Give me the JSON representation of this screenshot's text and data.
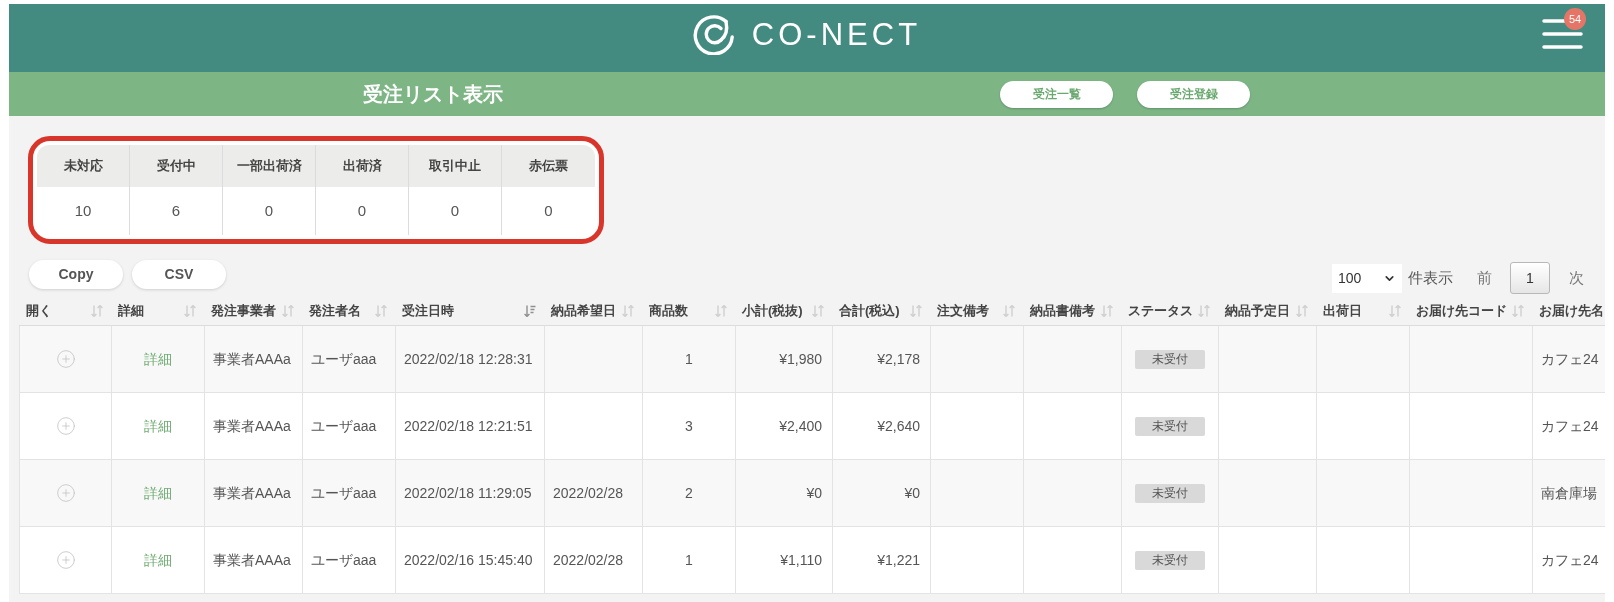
{
  "header": {
    "logo_text": "CO-NECT",
    "notification_count": "54"
  },
  "title_bar": {
    "title": "受注リスト表示",
    "buttons": [
      "受注一覧",
      "受注登録"
    ]
  },
  "status_summary": {
    "highlighted": true,
    "columns": [
      {
        "label": "未対応",
        "count": "10"
      },
      {
        "label": "受付中",
        "count": "6"
      },
      {
        "label": "一部出荷済",
        "count": "0"
      },
      {
        "label": "出荷済",
        "count": "0"
      },
      {
        "label": "取引中止",
        "count": "0"
      },
      {
        "label": "赤伝票",
        "count": "0"
      }
    ]
  },
  "toolbar": {
    "buttons": [
      "Copy",
      "CSV"
    ],
    "page_size": "100",
    "page_size_label": "件表示",
    "previous": "前",
    "current_page": "1",
    "next": "次"
  },
  "table": {
    "columns": [
      {
        "label": "開く",
        "sorted": false
      },
      {
        "label": "詳細",
        "sorted": false
      },
      {
        "label": "発注事業者",
        "sorted": false
      },
      {
        "label": "発注者名",
        "sorted": false
      },
      {
        "label": "受注日時",
        "sorted": true
      },
      {
        "label": "納品希望日",
        "sorted": false
      },
      {
        "label": "商品数",
        "sorted": false
      },
      {
        "label": "小計(税抜)",
        "sorted": false
      },
      {
        "label": "合計(税込)",
        "sorted": false
      },
      {
        "label": "注文備考",
        "sorted": false
      },
      {
        "label": "納品書備考",
        "sorted": false
      },
      {
        "label": "ステータス",
        "sorted": false
      },
      {
        "label": "納品予定日",
        "sorted": false
      },
      {
        "label": "出荷日",
        "sorted": false
      },
      {
        "label": "お届け先コード",
        "sorted": false
      },
      {
        "label": "お届け先名"
      }
    ],
    "rows": [
      {
        "expanded": false,
        "detail": "詳細",
        "orderer": "事業者AAAa",
        "user": "ユーザaaa",
        "ordered_at": "2022/02/18 12:28:31",
        "item_count": "1",
        "subtotal": "¥1,980",
        "total": "¥2,178",
        "status": "未受付",
        "destination_name": "カフェ24"
      },
      {
        "expanded": false,
        "detail": "詳細",
        "orderer": "事業者AAAa",
        "user": "ユーザaaa",
        "ordered_at": "2022/02/18 12:21:51",
        "item_count": "3",
        "subtotal": "¥2,400",
        "total": "¥2,640",
        "status": "未受付",
        "destination_name": "カフェ24"
      },
      {
        "expanded": false,
        "detail": "詳細",
        "orderer": "事業者AAAa",
        "user": "ユーザaaa",
        "ordered_at": "2022/02/18 11:29:05",
        "desired_date": "2022/02/28",
        "item_count": "2",
        "subtotal": "¥0",
        "total": "¥0",
        "status": "未受付",
        "destination_name": "南倉庫場"
      },
      {
        "expanded": false,
        "detail": "詳細",
        "orderer": "事業者AAAa",
        "user": "ユーザaaa",
        "ordered_at": "2022/02/16 15:45:40",
        "desired_date": "2022/02/28",
        "item_count": "1",
        "subtotal": "¥1,110",
        "total": "¥1,221",
        "status": "未受付",
        "destination_name": "カフェ24"
      }
    ]
  }
}
